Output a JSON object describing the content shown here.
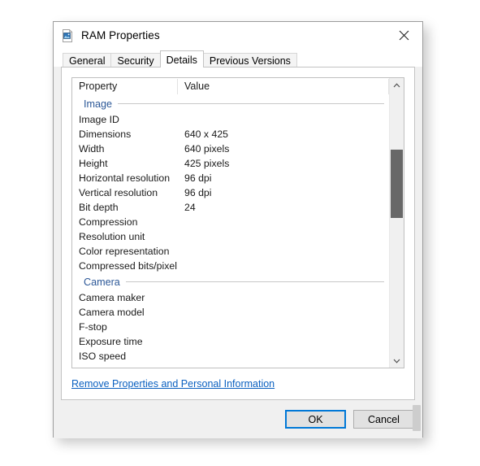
{
  "window": {
    "title": "RAM Properties",
    "icon": "image-file-icon",
    "close_label": "Close"
  },
  "tabs": [
    {
      "label": "General",
      "active": false
    },
    {
      "label": "Security",
      "active": false
    },
    {
      "label": "Details",
      "active": true
    },
    {
      "label": "Previous Versions",
      "active": false
    }
  ],
  "list": {
    "columns": {
      "property": "Property",
      "value": "Value"
    },
    "groups": [
      {
        "name": "Image",
        "rows": [
          {
            "property": "Image ID",
            "value": ""
          },
          {
            "property": "Dimensions",
            "value": "640 x 425"
          },
          {
            "property": "Width",
            "value": "640 pixels"
          },
          {
            "property": "Height",
            "value": "425 pixels"
          },
          {
            "property": "Horizontal resolution",
            "value": "96 dpi"
          },
          {
            "property": "Vertical resolution",
            "value": "96 dpi"
          },
          {
            "property": "Bit depth",
            "value": "24"
          },
          {
            "property": "Compression",
            "value": ""
          },
          {
            "property": "Resolution unit",
            "value": ""
          },
          {
            "property": "Color representation",
            "value": ""
          },
          {
            "property": "Compressed bits/pixel",
            "value": ""
          }
        ]
      },
      {
        "name": "Camera",
        "rows": [
          {
            "property": "Camera maker",
            "value": ""
          },
          {
            "property": "Camera model",
            "value": ""
          },
          {
            "property": "F-stop",
            "value": ""
          },
          {
            "property": "Exposure time",
            "value": ""
          },
          {
            "property": "ISO speed",
            "value": ""
          }
        ]
      }
    ]
  },
  "scrollbar": {
    "up_arrow": "chevron-up-icon",
    "down_arrow": "chevron-down-icon",
    "thumb_top_percent": 22,
    "thumb_height_percent": 26
  },
  "privacy_link": "Remove Properties and Personal Information",
  "footer": {
    "ok_label": "OK",
    "cancel_label": "Cancel"
  },
  "colors": {
    "group_header": "#2b5797",
    "link": "#0a60c0",
    "default_button_border": "#0078d7",
    "scroll_thumb": "#686868",
    "dialog_background": "#f0f0f0"
  }
}
